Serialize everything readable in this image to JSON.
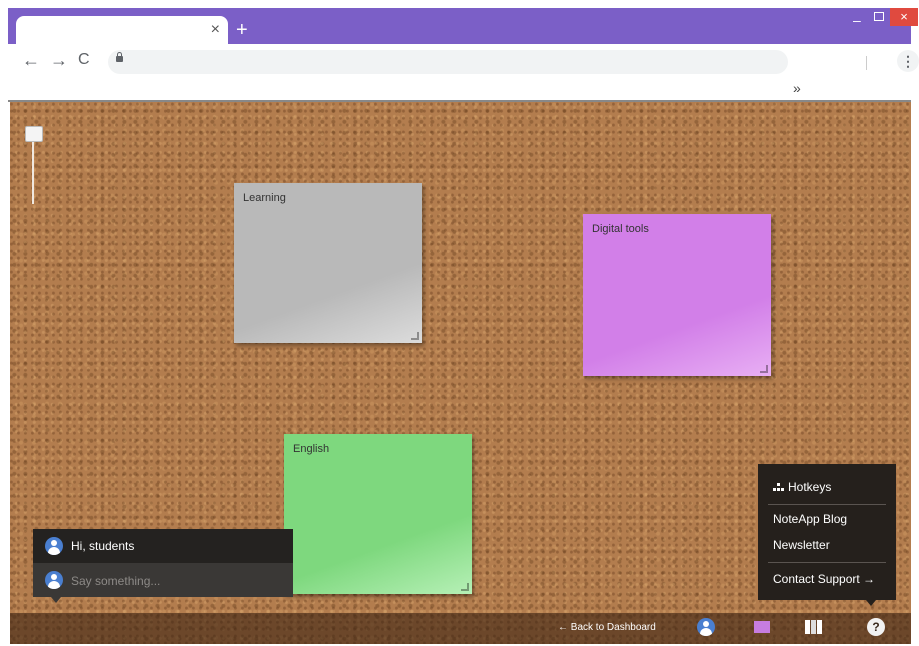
{
  "browser": {
    "tab_close": "×",
    "new_tab": "+",
    "window": {
      "minimize": "–",
      "close": "×"
    },
    "nav": {
      "back": "←",
      "forward": "→",
      "reload": "C"
    },
    "menu": "⋮",
    "bookmarks_overflow": "»"
  },
  "board": {
    "notes": [
      {
        "label": "Learning",
        "color": "#b9b9b9"
      },
      {
        "label": "Digital tools",
        "color": "#d27fe8"
      },
      {
        "label": "English",
        "color": "#7ed87e"
      }
    ]
  },
  "chat": {
    "greeting": "Hi, students",
    "input_placeholder": "Say something..."
  },
  "help_menu": {
    "hotkeys": "Hotkeys",
    "blog": "NoteApp Blog",
    "newsletter": "Newsletter",
    "contact": "Contact Support →"
  },
  "bottom_bar": {
    "back_link": "← Back to Dashboard",
    "help": "?"
  },
  "colors": {
    "chrome_accent": "#7b5fc7",
    "cork": "#b37d4e"
  }
}
